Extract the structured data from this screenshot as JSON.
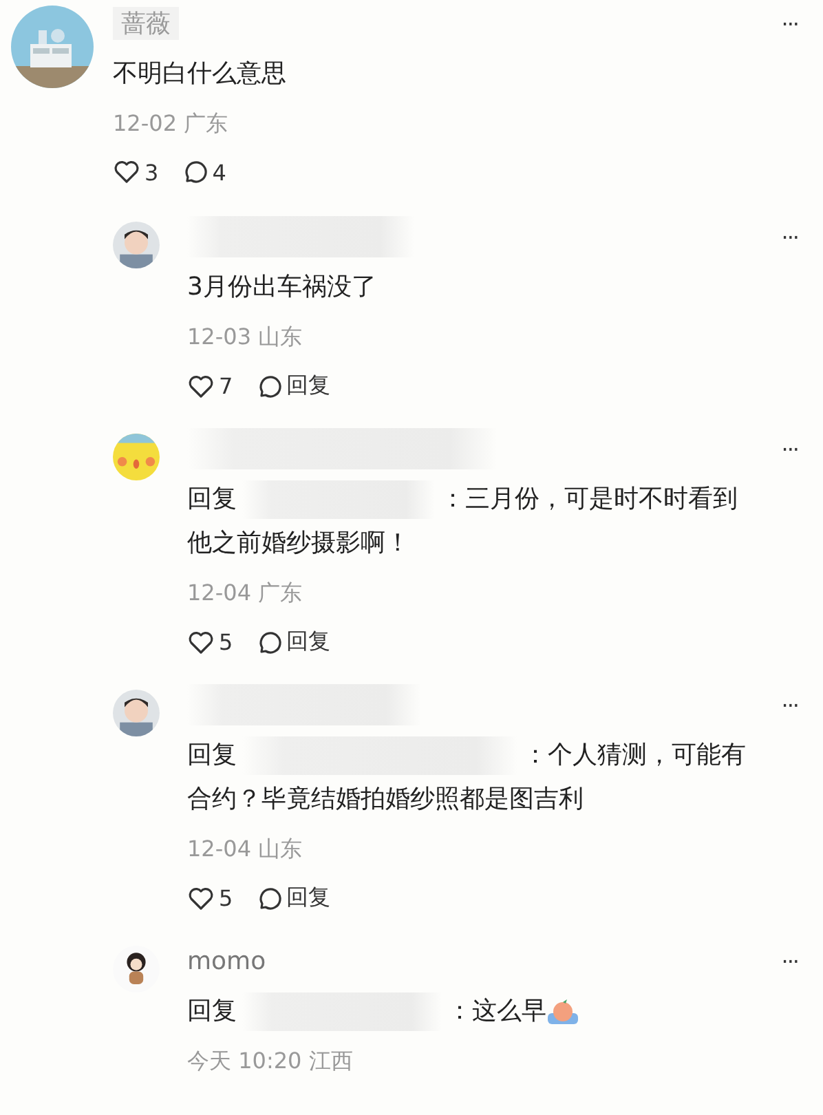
{
  "comment": {
    "name": "蔷薇",
    "name_hidden": false,
    "name_faded": true,
    "text": "不明白什么意思",
    "meta": "12-02 广东",
    "likes": "3",
    "reply_count": "4",
    "more": "···",
    "replies": [
      {
        "name_hidden": true,
        "lines": [
          "3月份出车祸没了"
        ],
        "meta": "12-03 山东",
        "likes": "7",
        "reply_action": "回复",
        "more": "···"
      },
      {
        "name_hidden": true,
        "reply_prefix": "回复",
        "lines": [
          "：三月份，可是时不时看到",
          "他之前婚纱摄影啊！"
        ],
        "meta": "12-04 广东",
        "likes": "5",
        "reply_action": "回复",
        "more": "···"
      },
      {
        "name_hidden": true,
        "reply_prefix": "回复",
        "lines": [
          "：个人猜测，可能有",
          "合约？毕竟结婚拍婚纱照都是图吉利"
        ],
        "meta": "12-04 山东",
        "likes": "5",
        "reply_action": "回复",
        "more": "···"
      },
      {
        "name_hidden": false,
        "name": "momo",
        "reply_prefix": "回复",
        "lines": [
          "：这么早"
        ],
        "sticker": true,
        "meta": "今天 10:20 江西",
        "more": "···"
      }
    ]
  }
}
